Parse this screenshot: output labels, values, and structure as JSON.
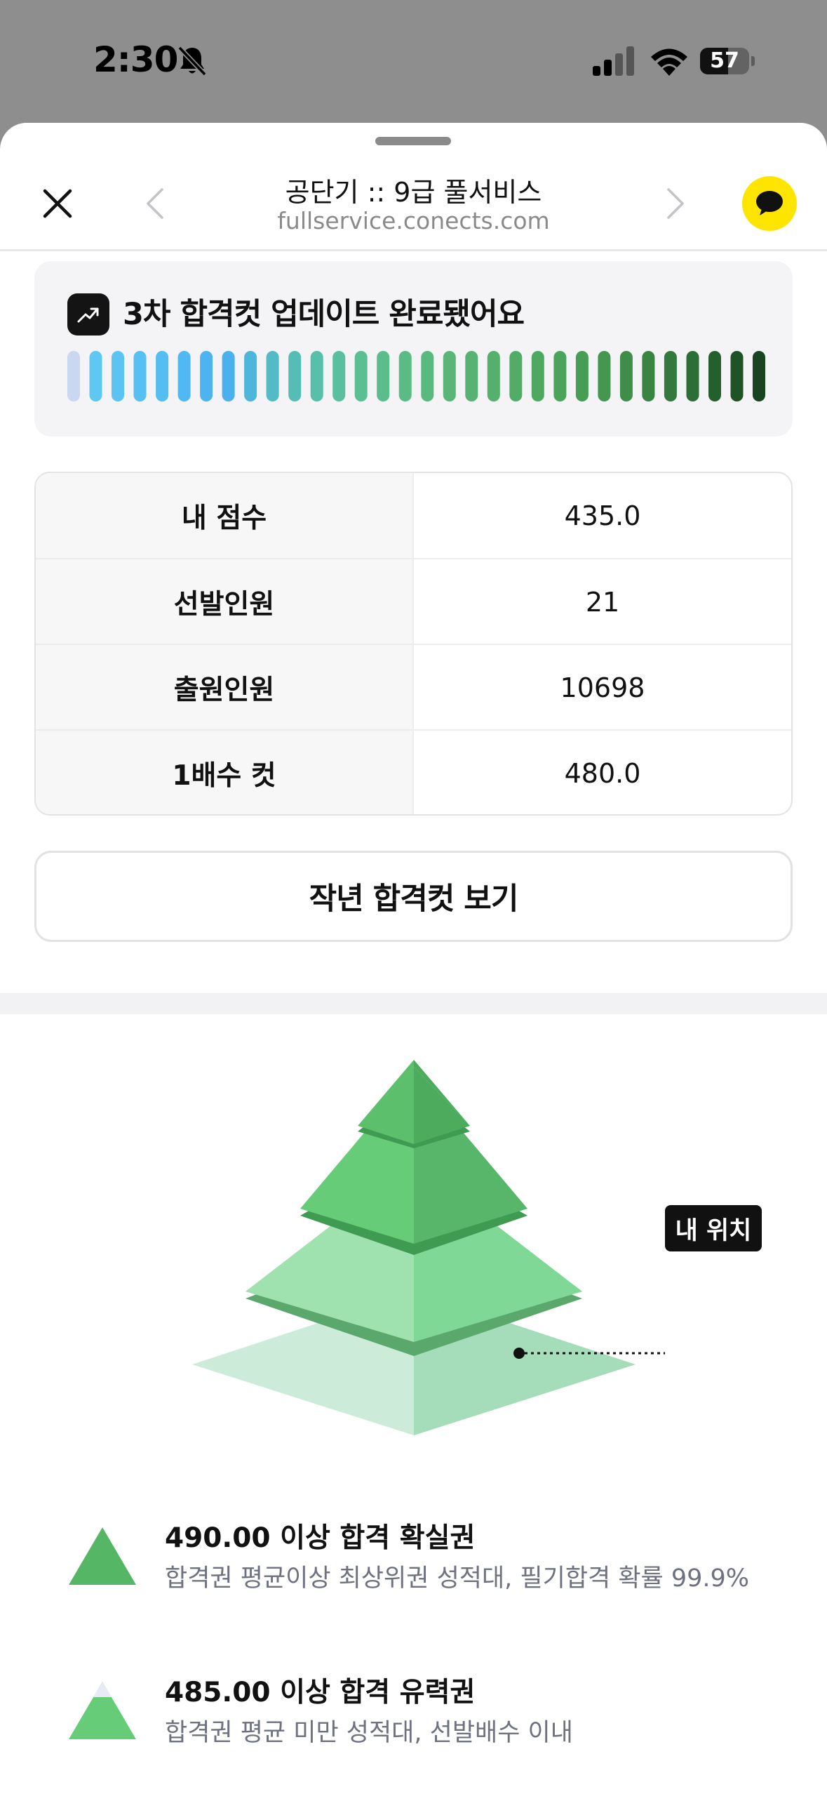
{
  "status_bar": {
    "time": "2:30",
    "battery_label": "57",
    "battery_level": 0.57,
    "icons": [
      "bell-slash-icon",
      "signal-icon",
      "wifi-icon",
      "battery-icon"
    ]
  },
  "nav": {
    "title": "공단기 :: 9급 풀서비스",
    "url": "fullservice.conects.com",
    "icons": [
      "close-icon",
      "chevron-left-icon",
      "chevron-right-icon",
      "kakao-chat-icon"
    ]
  },
  "banner": {
    "text": "3차 합격컷 업데이트 완료됐어요",
    "icon": "trend-up-icon",
    "bar_colors": [
      "#c9d7f0",
      "#5ec8f2",
      "#5bc4f2",
      "#57c0f2",
      "#54bdf2",
      "#50b8f2",
      "#4db4f0",
      "#4ab0ee",
      "#4eb6da",
      "#52bbc6",
      "#56bdb6",
      "#58bfa8",
      "#5abf9e",
      "#5bbf94",
      "#5bbd8c",
      "#5bbb84",
      "#5ab97e",
      "#59b678",
      "#57b373",
      "#55b06d",
      "#52ac67",
      "#4fa862",
      "#4ca35c",
      "#489d56",
      "#449650",
      "#3f8d4a",
      "#398343",
      "#33793d",
      "#2c6e36",
      "#255f2e",
      "#1f5227",
      "#1a4421"
    ]
  },
  "score_table": {
    "rows": [
      {
        "label": "내 점수",
        "value": "435.0"
      },
      {
        "label": "선발인원",
        "value": "21"
      },
      {
        "label": "출원인원",
        "value": "10698"
      },
      {
        "label": "1배수 컷",
        "value": "480.0"
      }
    ]
  },
  "prev_cut_button": {
    "label": "작년 합격컷 보기"
  },
  "pyramid": {
    "my_position_label": "내 위치",
    "colors": {
      "tier1_left": "#5cbf6c",
      "tier1_right": "#4cab5c",
      "tier2_left": "#66cc78",
      "tier2_right": "#58b66a",
      "tier3_left": "#9fe2b0",
      "tier3_right": "#80d896",
      "tier4_left": "#cdebd9",
      "tier4_right": "#a5dcb9",
      "band": "#3f9a52"
    }
  },
  "legend": [
    {
      "title": "490.00 이상 합격 확실권",
      "desc": "합격권 평균이상 최상위권 성적대, 필기합격 확률 99.9%",
      "color": "#55b766",
      "icon": "triangle-full-icon"
    },
    {
      "title": "485.00 이상 합격 유력권",
      "desc": "합격권 평균 미만 성적대, 선발배수 이내",
      "color": "#66cc78",
      "cap_color": "#e8eaf6",
      "icon": "triangle-partial-icon"
    }
  ]
}
